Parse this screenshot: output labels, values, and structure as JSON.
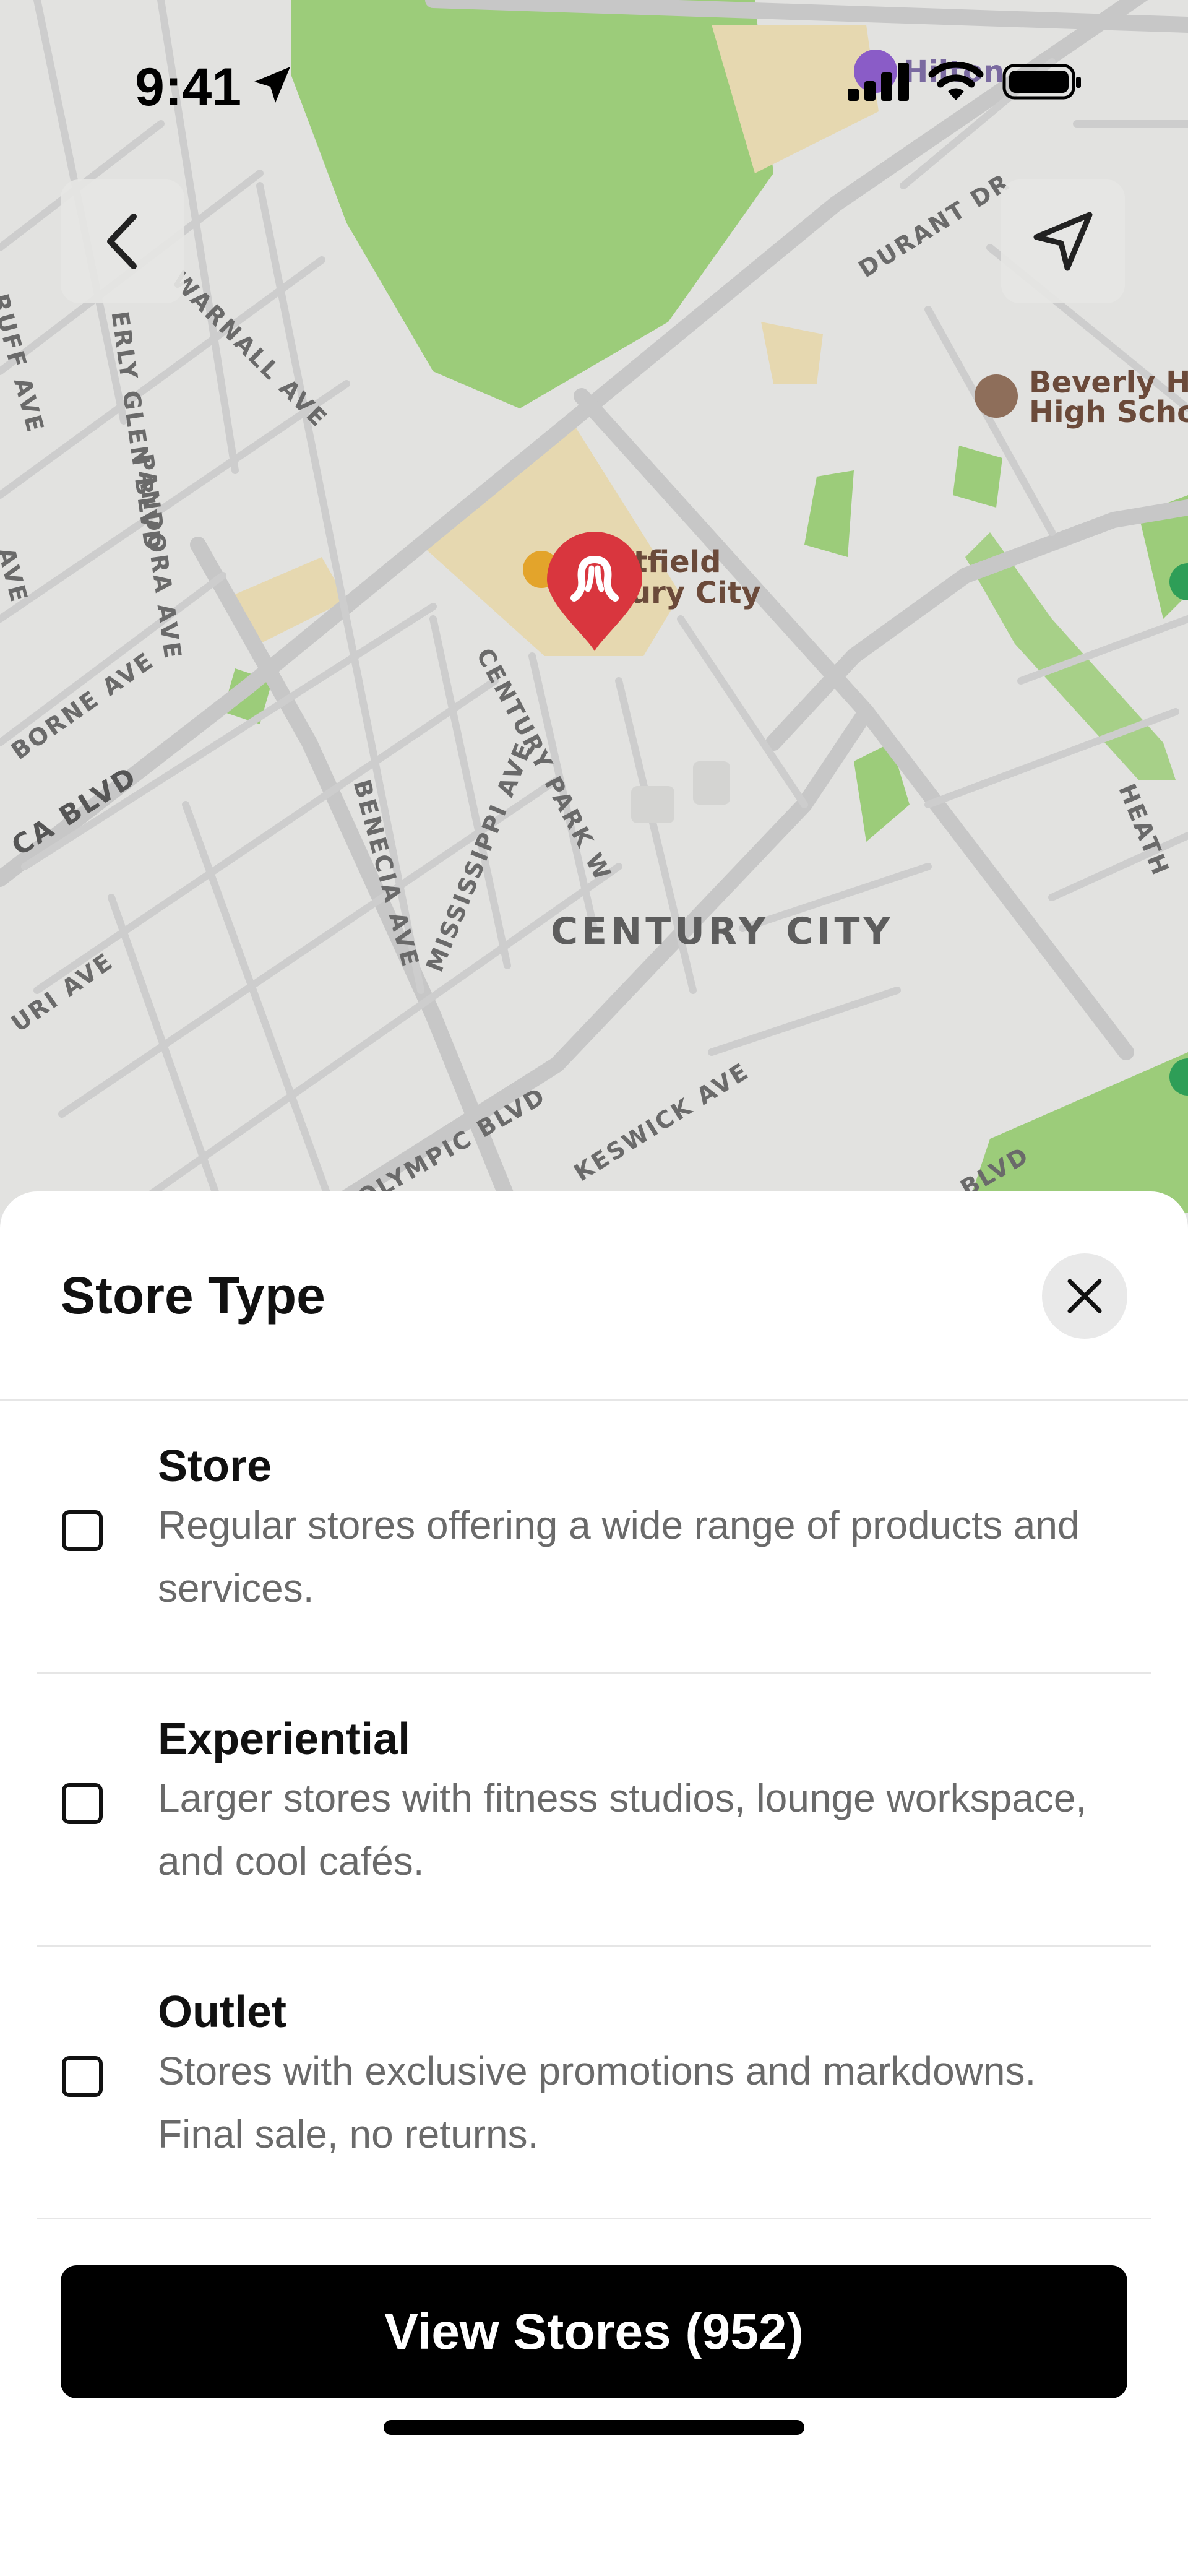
{
  "status_bar": {
    "time": "9:41"
  },
  "map": {
    "district_label": "CENTURY CITY",
    "street_labels": {
      "warnall": "WARNALL AVE",
      "glen": "ERLY GLEN BLVD",
      "pandora": "PANDORA AVE",
      "century_park": "CENTURY PARK W",
      "benecia": "BENECIA AVE",
      "mississippi": "MISSISSIPPI AVE",
      "olympic": "OLYMPIC BLVD",
      "keswick": "KESWICK AVE",
      "durant": "DURANT DR",
      "santa_monica": "CA BLVD",
      "borne": "BORNE AVE",
      "uri": "URI AVE",
      "uff": "RUFF AVE",
      "ave": "AVE",
      "heath": "HEATH",
      "o_blvd": "O BLVD"
    },
    "poi": {
      "westfield_line1": "stfield",
      "westfield_line2": "tury City",
      "hilton": "Hilton",
      "beverly_line1": "Beverly Hi",
      "beverly_line2": "High Scho"
    },
    "accent_pin_color": "#d9363e"
  },
  "sheet": {
    "title": "Store Type",
    "options": [
      {
        "title": "Store",
        "description": "Regular stores offering a wide range of products and services."
      },
      {
        "title": "Experiential",
        "description": "Larger stores with fitness studios, lounge workspace, and cool cafés."
      },
      {
        "title": "Outlet",
        "description": "Stores with exclusive promotions and markdowns. Final sale, no returns."
      }
    ],
    "cta_label": "View Stores (952)"
  }
}
